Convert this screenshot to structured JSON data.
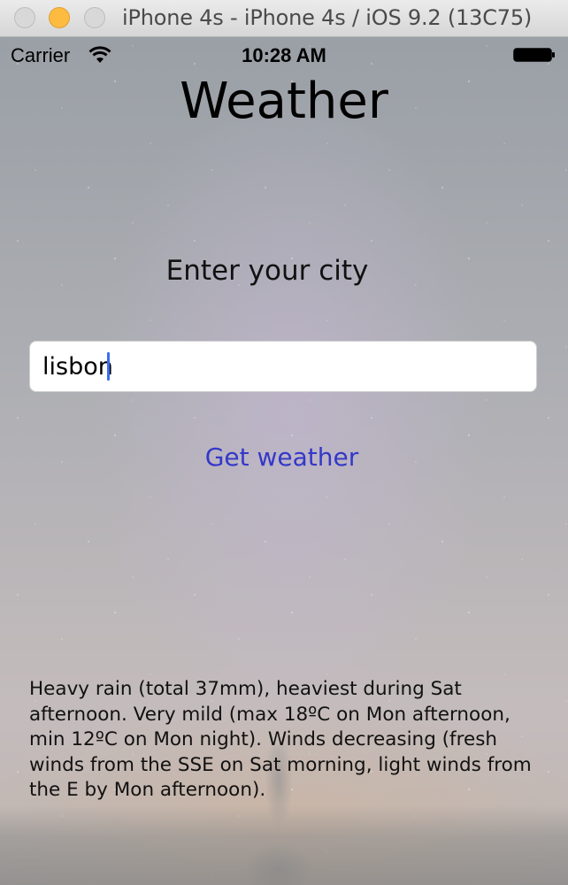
{
  "window": {
    "title": "iPhone 4s - iPhone 4s / iOS 9.2 (13C75)"
  },
  "status_bar": {
    "carrier": "Carrier",
    "time": "10:28 AM",
    "icons": [
      "wifi-icon",
      "battery-icon"
    ]
  },
  "app": {
    "title": "Weather",
    "prompt": "Enter your city",
    "city_input": {
      "value": "lisbon",
      "placeholder": ""
    },
    "get_weather_label": "Get weather",
    "forecast": "Heavy rain (total 37mm), heaviest during Sat afternoon. Very mild (max 18ºC on Mon afternoon, min 12ºC on Mon night). Winds decreasing (fresh winds from the SSE on Sat morning, light winds from the E by Mon afternoon)."
  },
  "colors": {
    "button_text": "#3438c9",
    "caret": "#3b6df0",
    "minimize_button": "#fdbc40"
  }
}
